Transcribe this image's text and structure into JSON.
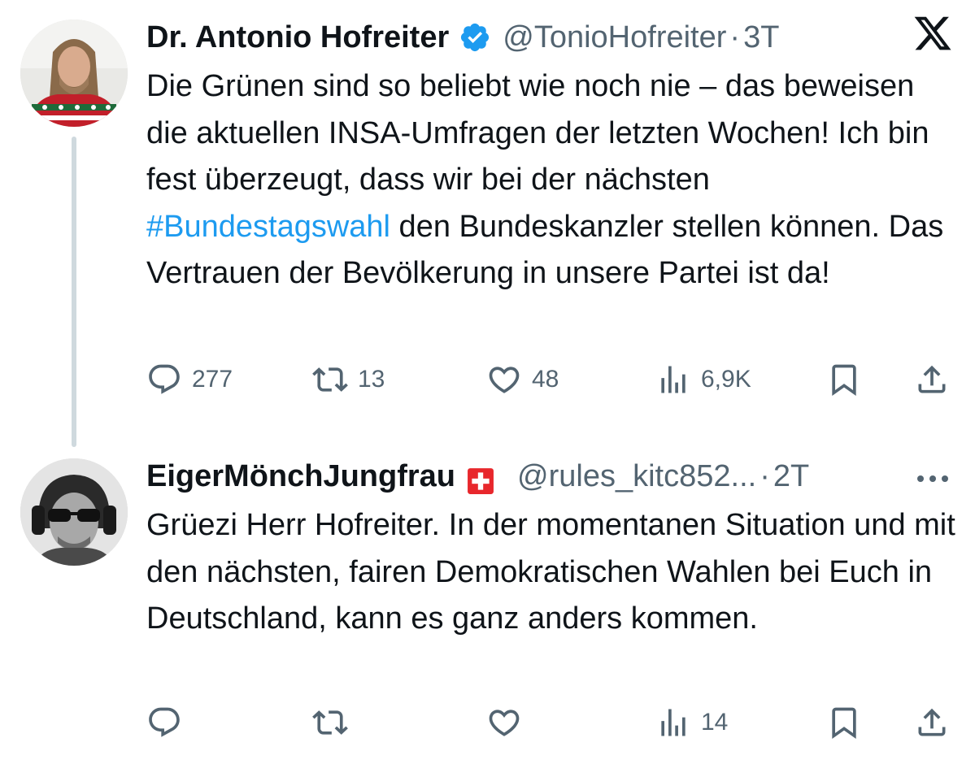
{
  "tweets": [
    {
      "author": {
        "name": "Dr. Antonio Hofreiter",
        "handle": "@TonioHofreiter",
        "verified": true
      },
      "separator": "·",
      "time": "3T",
      "text_parts": [
        "Die Grünen sind so beliebt wie noch nie – das beweisen die aktuellen INSA-Umfragen der letzten Wochen! Ich bin fest überzeugt, dass wir bei der nächsten ",
        "#Bundestagswahl",
        " den Bundeskanzler stellen können. Das Vertrauen der Bevölkerung in unsere Partei ist da!"
      ],
      "stats": {
        "replies": "277",
        "reposts": "13",
        "likes": "48",
        "views": "6,9K"
      },
      "corner_icon": "x-logo-icon"
    },
    {
      "author": {
        "name": "EigerMönchJungfrau",
        "handle": "@rules_kitc852...",
        "flag": "swiss-flag-icon"
      },
      "separator": "·",
      "time": "2T",
      "text": "Grüezi Herr Hofreiter. In der momentanen Situation und mit den nächsten, fairen Demokratischen Wahlen bei Euch in Deutschland, kann es ganz anders kommen.",
      "stats": {
        "views": "14"
      },
      "corner_icon": "more-icon"
    }
  ],
  "colors": {
    "text": "#0f1419",
    "secondary": "#536471",
    "link": "#1d9bf0",
    "verified": "#1d9bf0",
    "thread_line": "#cfd9de",
    "swiss_red": "#e8272c"
  }
}
